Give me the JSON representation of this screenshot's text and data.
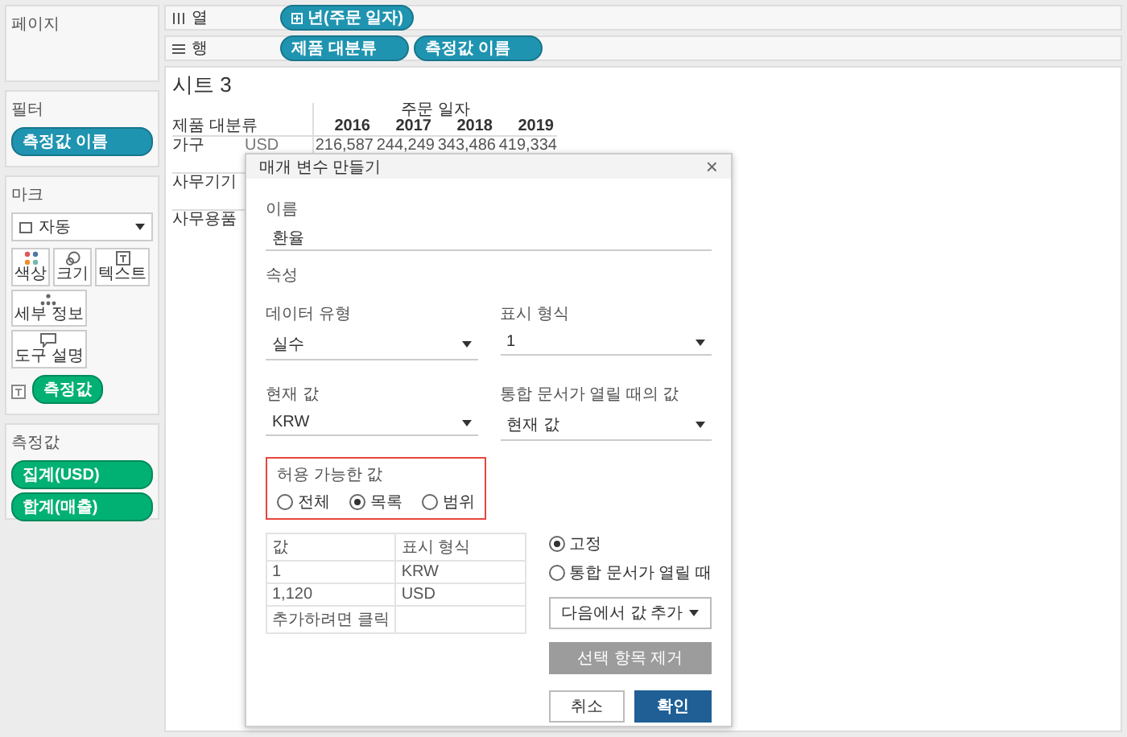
{
  "side_panel": {
    "pages": {
      "title": "페이지"
    },
    "filters": {
      "title": "필터",
      "pills": [
        {
          "label": "측정값 이름",
          "kind": "discrete"
        }
      ]
    },
    "marks": {
      "title": "마크",
      "mark_type": "자동",
      "buttons": [
        {
          "label": "색상",
          "kind": "color"
        },
        {
          "label": "크기",
          "kind": "size"
        },
        {
          "label": "텍스트",
          "kind": "text"
        },
        {
          "label": "세부 정보",
          "kind": "detail"
        },
        {
          "label": "도구 설명",
          "kind": "tooltip"
        }
      ],
      "pills": [
        {
          "label": "측정값",
          "kind": "continuous"
        }
      ]
    },
    "measure_values": {
      "title": "측정값",
      "pills": [
        {
          "label": "집계(USD)",
          "kind": "continuous"
        },
        {
          "label": "합계(매출)",
          "kind": "continuous"
        }
      ]
    }
  },
  "shelves": [
    {
      "kind": "columns",
      "label": "열",
      "pills": [
        {
          "label": "년(주문 일자)",
          "kind": "discrete",
          "expandable": true
        }
      ]
    },
    {
      "kind": "rows",
      "label": "행",
      "pills": [
        {
          "label": "제품 대분류",
          "kind": "discrete",
          "expandable": false
        },
        {
          "label": "측정값 이름",
          "kind": "discrete",
          "expandable": false
        }
      ]
    }
  ],
  "sheet": {
    "title": "시트 3",
    "column_header": "주문 일자",
    "row_header": "제품 대분류",
    "years": [
      "2016",
      "2017",
      "2018",
      "2019"
    ],
    "rows": [
      {
        "category": "가구",
        "measure": "USD",
        "values": [
          "216,587",
          "244,249",
          "343,486",
          "419,334"
        ]
      },
      {
        "category": "사무기기"
      },
      {
        "category": "사무용품"
      }
    ]
  },
  "dialog": {
    "title": "매개 변수 만들기",
    "close": "×",
    "name_label": "이름",
    "name_value": "환율",
    "properties_label": "속성",
    "dropdowns": [
      {
        "label": "데이터 유형",
        "value": "실수"
      },
      {
        "label": "표시 형식",
        "value": "1"
      },
      {
        "label": "현재 값",
        "value": "KRW"
      },
      {
        "label": "통합 문서가 열릴 때의 값",
        "value": "현재 값"
      }
    ],
    "allowable_values": {
      "label": "허용 가능한 값",
      "highlighted": true,
      "options": [
        {
          "label": "전체",
          "selected": false
        },
        {
          "label": "목록",
          "selected": true
        },
        {
          "label": "범위",
          "selected": false
        }
      ]
    },
    "value_list": {
      "columns": [
        "값",
        "표시 형식"
      ],
      "rows": [
        {
          "value": "1",
          "display": "KRW"
        },
        {
          "value": "1,120",
          "display": "USD"
        },
        {
          "value": "추가하려면 클릭"
        }
      ]
    },
    "value_source": [
      {
        "label": "고정",
        "selected": true
      },
      {
        "label": "통합 문서가 열릴 때",
        "selected": false
      }
    ],
    "add_values_button": "다음에서 값 추가",
    "remove_button": {
      "label": "선택 항목 제거",
      "disabled": true
    },
    "buttons": [
      {
        "label": "취소",
        "kind": "secondary"
      },
      {
        "label": "확인",
        "kind": "primary"
      }
    ]
  }
}
